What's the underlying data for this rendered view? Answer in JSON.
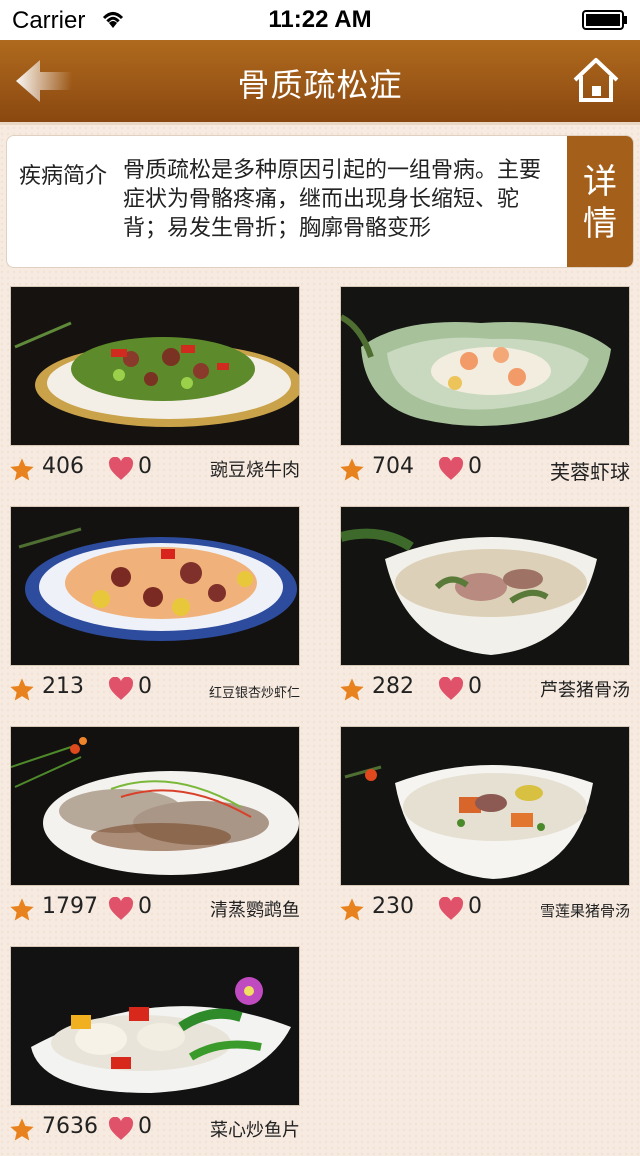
{
  "status": {
    "carrier": "Carrier",
    "time": "11:22 AM"
  },
  "nav": {
    "title": "骨质疏松症"
  },
  "intro": {
    "label": "疾病简介",
    "text": "骨质疏松是多种原因引起的一组骨病。主要症状为骨骼疼痛，继而出现身长缩短、驼背；易发生骨折；胸廓骨骼变形",
    "detail_label_1": "详",
    "detail_label_2": "情"
  },
  "dishes": [
    {
      "name": "豌豆烧牛肉",
      "views": "406",
      "likes": "0"
    },
    {
      "name": "芙蓉虾球",
      "views": "704",
      "likes": "0"
    },
    {
      "name": "红豆银杏炒虾仁",
      "views": "213",
      "likes": "0"
    },
    {
      "name": "芦荟猪骨汤",
      "views": "282",
      "likes": "0"
    },
    {
      "name": "清蒸鹦鹉鱼",
      "views": "1797",
      "likes": "0"
    },
    {
      "name": "雪莲果猪骨汤",
      "views": "230",
      "likes": "0"
    },
    {
      "name": "菜心炒鱼片",
      "views": "7636",
      "likes": "0"
    }
  ],
  "colors": {
    "nav": "#9a5516",
    "accent": "#a45f1a",
    "star": "#e8821e",
    "heart": "#e0526a"
  }
}
